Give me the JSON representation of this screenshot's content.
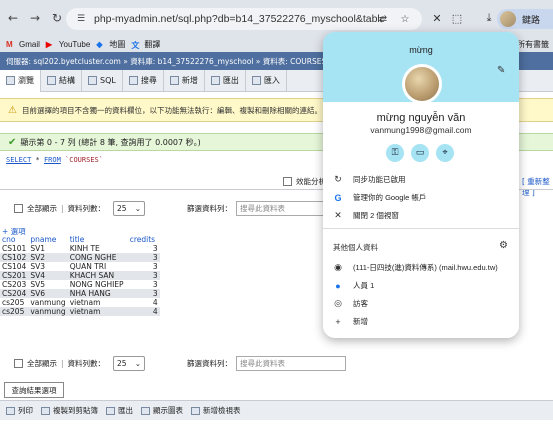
{
  "browser": {
    "url": "php-myadmin.net/sql.php?db=b14_37522276_myschool&table=COU...",
    "profile_label": "鍵路",
    "bookmarks": [
      {
        "icon": "gmail-icon",
        "label": "Gmail"
      },
      {
        "icon": "youtube-icon",
        "label": "YouTube"
      },
      {
        "icon": "maps-icon",
        "label": "地圖"
      },
      {
        "icon": "translate-icon",
        "label": "翻譯"
      }
    ],
    "bookmarks_right": "所有書籤"
  },
  "pma": {
    "breadcrumb": "伺服器: sql202.byetcluster.com » 資料庫: b14_37522276_myschool » 資料表: COURSES",
    "tabs": [
      {
        "label": "瀏覽",
        "active": true
      },
      {
        "label": "結構",
        "active": false
      },
      {
        "label": "SQL",
        "active": false
      },
      {
        "label": "搜尋",
        "active": false
      },
      {
        "label": "新增",
        "active": false
      },
      {
        "label": "匯出",
        "active": false
      },
      {
        "label": "匯入",
        "active": false
      }
    ],
    "warning": "目前選擇的項目不含獨一的資料欄位，以下功能無法執行：編輯、複製和刪除相關的連結。",
    "success": "顯示第 0 - 7 列 (總計 8 筆, 查詢用了 0.0007 秒。)",
    "sql": {
      "kw1": "SELECT",
      "star": " * ",
      "kw2": "FROM",
      "tbl": " `COURSES`"
    },
    "profiling_label": "效能分析",
    "edit_inline": "[ 重新整理 ]",
    "show_all": "全部顯示",
    "rows_label": "資料列數：",
    "rows_value": "25",
    "filter_label": "篩選資料列：",
    "filter_placeholder": "搜尋此資料表",
    "options_link": "+ 選項",
    "columns": [
      "cno",
      "pname",
      "title",
      "credits"
    ],
    "rows": [
      [
        "CS101",
        "SV1",
        "KINH TE",
        "3"
      ],
      [
        "CS102",
        "SV2",
        "CONG NGHE",
        "3"
      ],
      [
        "CS104",
        "SV3",
        "QUAN TRI",
        "3"
      ],
      [
        "CS201",
        "SV4",
        "KHACH SAN",
        "3"
      ],
      [
        "CS203",
        "SV5",
        "NONG NGHIEP",
        "3"
      ],
      [
        "CS204",
        "SV6",
        "NHA HANG",
        "3"
      ],
      [
        "cs205",
        "vanmung",
        "vietnam",
        "4"
      ],
      [
        "cs205",
        "vanmung",
        "vietnam",
        "4"
      ]
    ],
    "query_results_ops": "查詢結果選項",
    "bottom": [
      {
        "label": "列印"
      },
      {
        "label": "複製到剪貼簿"
      },
      {
        "label": "匯出"
      },
      {
        "label": "顯示圖表"
      },
      {
        "label": "新增檢視表"
      }
    ]
  },
  "profile_popup": {
    "title": "mừng",
    "name": "mừng nguyễn văn",
    "email": "vanmung1998@gmail.com",
    "sync": "同步功能已啟用",
    "manage": "管理你的 Google 帳戶",
    "close_windows": "關閉 2 個視窗",
    "other_profiles": "其他個人資料",
    "profiles": [
      {
        "icon": "avatar",
        "label": "(111-日四技(進)資料傳系) (mail.hwu.edu.tw)"
      },
      {
        "icon": "person-icon",
        "label": "人員 1"
      },
      {
        "icon": "guest-icon",
        "label": "訪客"
      },
      {
        "icon": "plus-icon",
        "label": "新增"
      }
    ]
  }
}
